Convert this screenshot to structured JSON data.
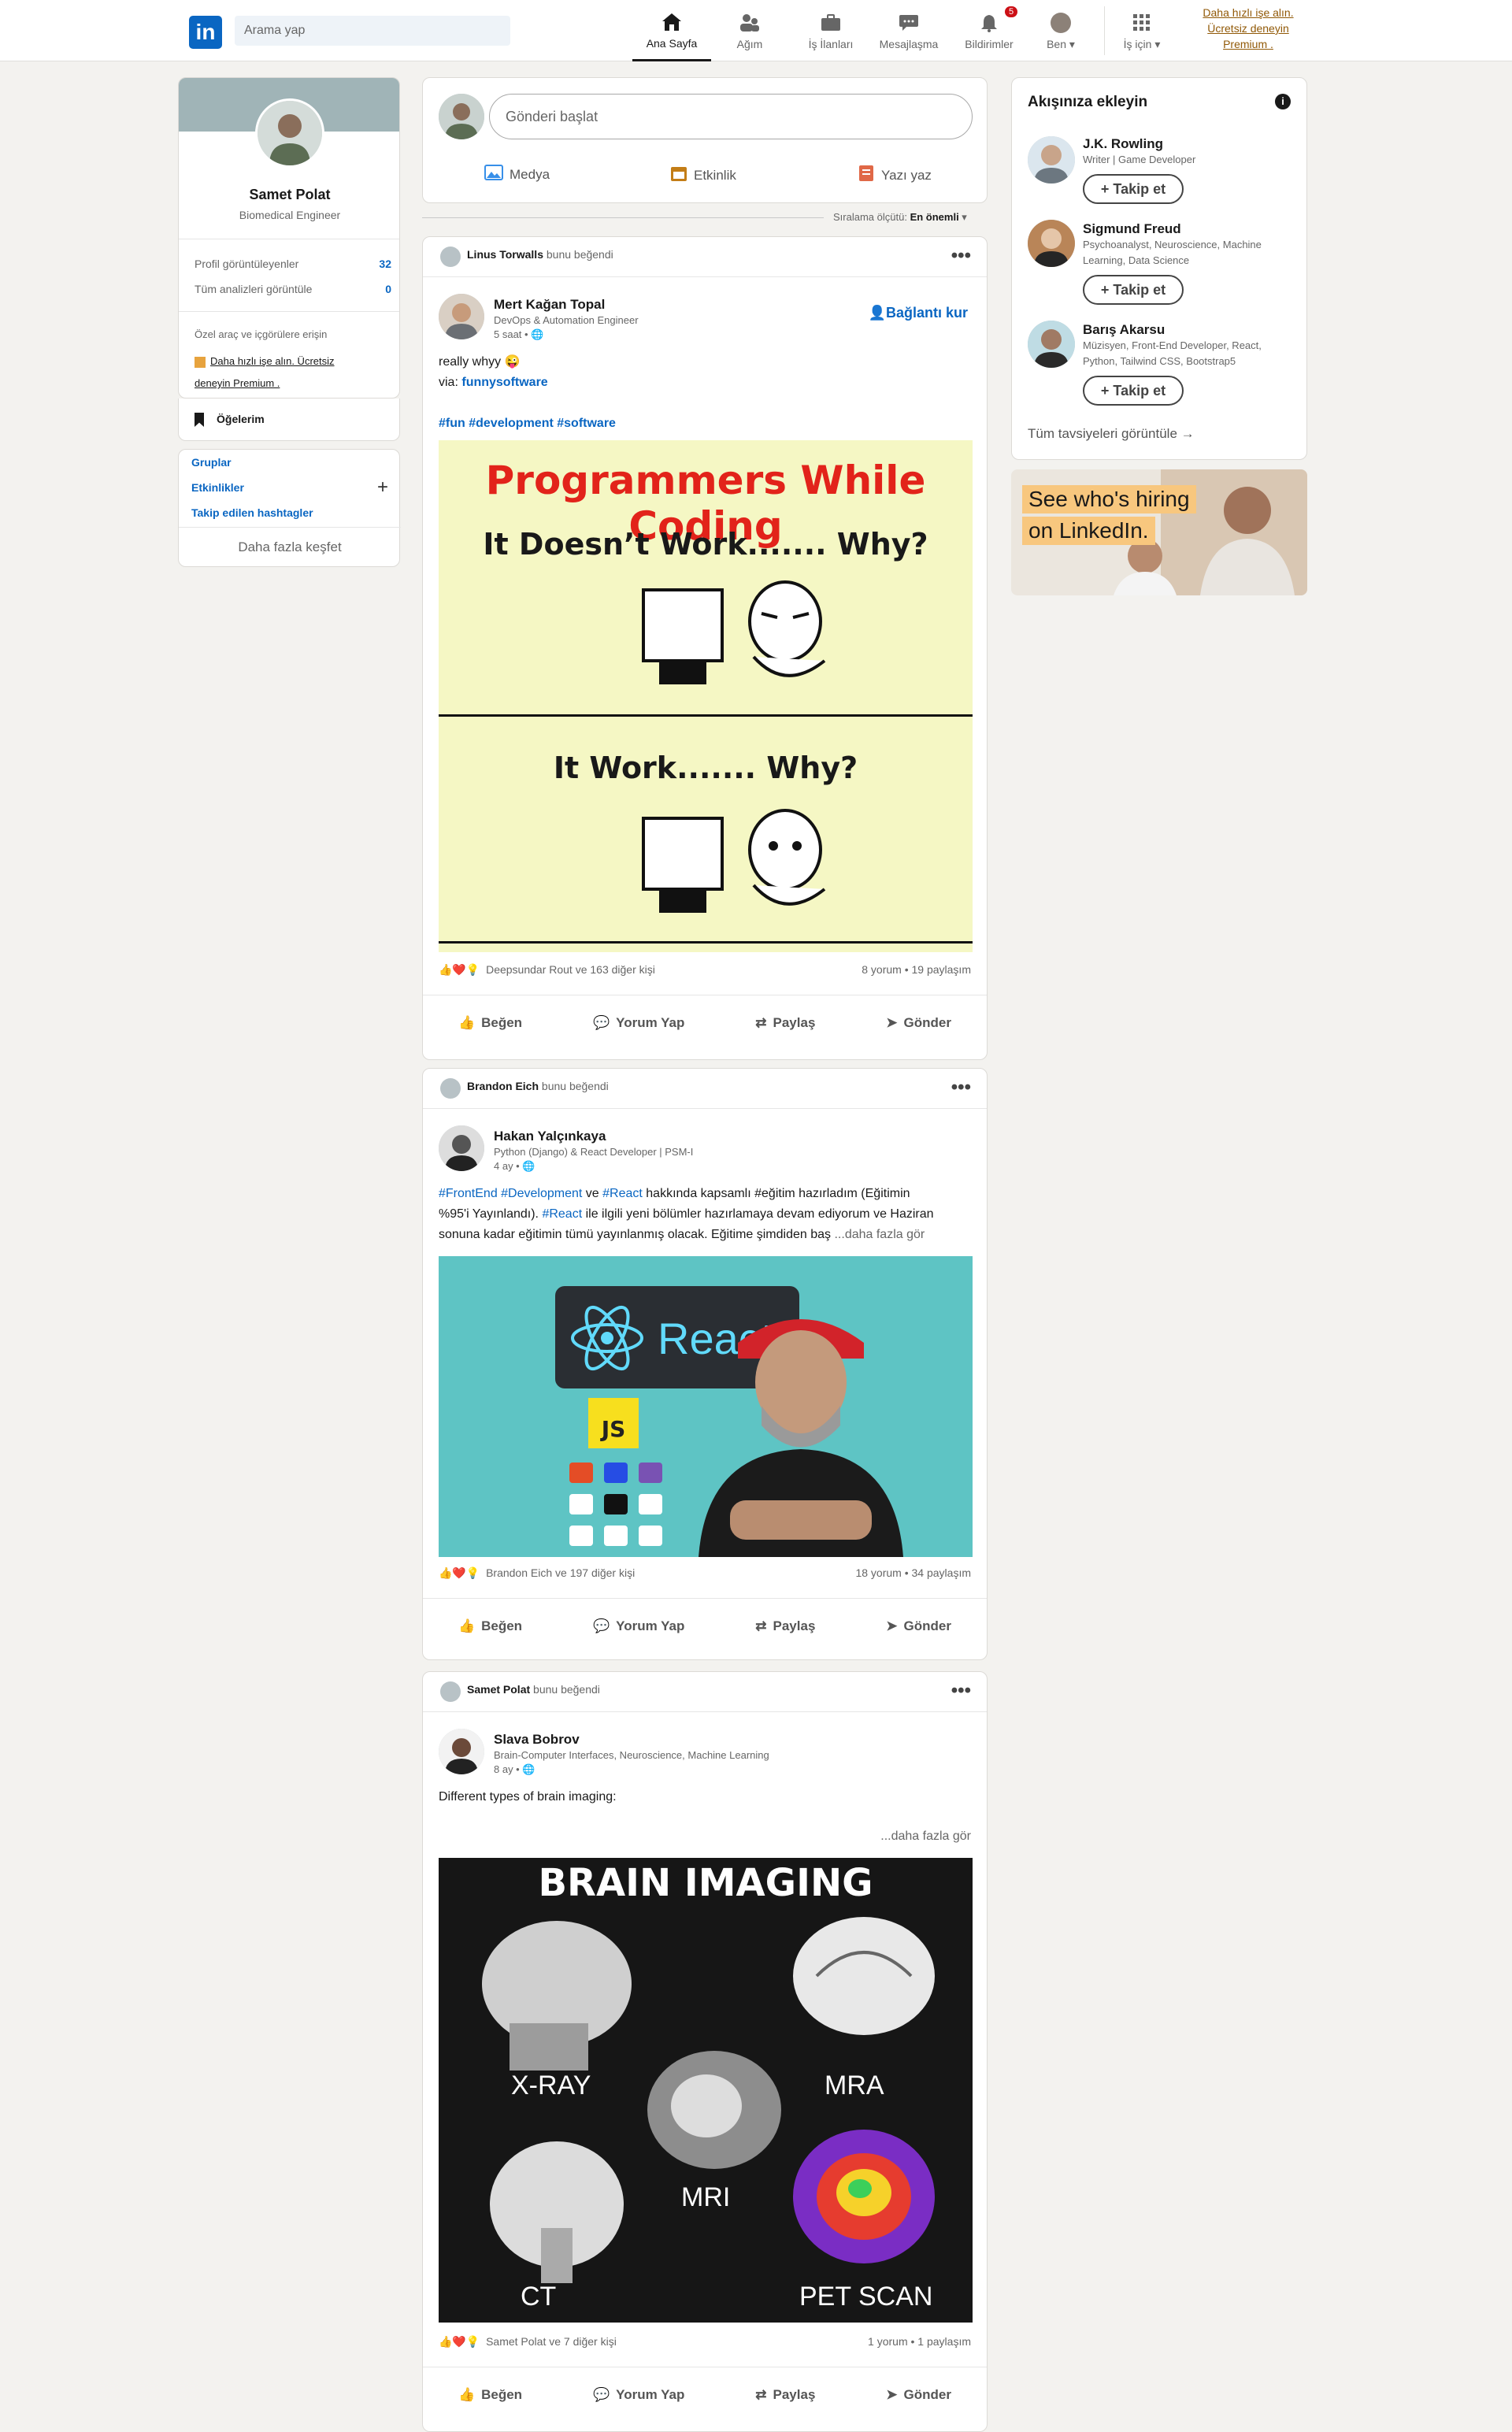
{
  "topbar": {
    "search_placeholder": "Arama yap",
    "nav": [
      {
        "label": "Ana Sayfa",
        "icon": "home-icon"
      },
      {
        "label": "Ağım",
        "icon": "network-icon"
      },
      {
        "label": "İş İlanları",
        "icon": "briefcase-icon"
      },
      {
        "label": "Mesajlaşma",
        "icon": "message-icon"
      },
      {
        "label": "Bildirimler",
        "icon": "bell-icon",
        "badge": "5"
      },
      {
        "label": "Ben",
        "icon": "avatar-icon"
      },
      {
        "label": "İş için",
        "icon": "grid-icon"
      }
    ],
    "premium": "Daha hızlı işe alın. Ücretsiz deneyin Premium ."
  },
  "profile": {
    "name": "Samet Polat",
    "headline": "Biomedical Engineer",
    "viewers_label": "Profil görüntüleyenler",
    "viewers_value": "32",
    "analytics_label": "Tüm analizleri görüntüle",
    "analytics_value": "0",
    "tools_label": "Özel araç ve içgörülere erişin",
    "premium_line1": "Daha hızlı işe alın. Ücretsiz",
    "premium_line2": "deneyin Premium .",
    "items_label": "Öğelerim"
  },
  "communities": {
    "groups": "Gruplar",
    "events": "Etkinlikler",
    "hashtags": "Takip edilen hashtagler",
    "discover": "Daha fazla keşfet"
  },
  "composer": {
    "placeholder": "Gönderi başlat",
    "media": "Medya",
    "event": "Etkinlik",
    "article": "Yazı yaz"
  },
  "sort": {
    "label": "Sıralama ölçütü:",
    "value": "En önemli"
  },
  "posts": [
    {
      "liker": "Linus Torwalls",
      "liked": "bunu beğendi",
      "author": "Mert Kağan Topal",
      "desc": "DevOps & Automation Engineer",
      "time": "5 saat •",
      "connect": "Bağlantı kur",
      "text1": "really whyy 😜",
      "text2_prefix": "via:",
      "text2_link": "funnysoftware",
      "hashtags": "#fun #development #software",
      "meme_title": "Programmers While Coding",
      "meme_q1": "It Doesn’t Work....... Why?",
      "meme_q2": "It Work....... Why?",
      "reactions": "Deepsundar Rout ve 163 diğer kişi",
      "counts": "8 yorum • 19 paylaşım"
    },
    {
      "liker": "Brandon Eich",
      "liked": "bunu beğendi",
      "author": "Hakan Yalçınkaya",
      "desc": "Python (Django) & React Developer | PSM-I",
      "time": "4 ay •",
      "text_line1_a": "#FrontEnd #Development",
      "text_line1_b": " ve ",
      "text_line1_c": "#React",
      "text_line1_d": " hakkında kapsamlı #eğitim hazırladım (Eğitimin",
      "text_line2_a": "%95'i Yayınlandı). ",
      "text_line2_b": "#React",
      "text_line2_c": " ile ilgili yeni bölümler hazırlamaya devam ediyorum ve Haziran",
      "text_line3": "sonuna kadar eğitimin tümü yayınlanmış olacak. Eğitime şimdiden baş",
      "more": "...daha fazla gör",
      "image_word": "React",
      "image_js": "JS",
      "reactions": "Brandon Eich ve 197 diğer kişi",
      "counts": "18 yorum • 34 paylaşım"
    },
    {
      "liker": "Samet Polat",
      "liked": "bunu beğendi",
      "author": "Slava Bobrov",
      "desc": "Brain-Computer Interfaces, Neuroscience, Machine Learning",
      "time": "8 ay •",
      "text1": "Different types of brain imaging:",
      "more": "...daha fazla gör",
      "image_title": "BRAIN IMAGING",
      "labels": [
        "X-RAY",
        "MRA",
        "MRI",
        "CT",
        "PET SCAN"
      ],
      "reactions": "Samet Polat ve 7 diğer kişi",
      "counts": "1 yorum • 1 paylaşım"
    }
  ],
  "actions": {
    "like": "Beğen",
    "comment": "Yorum Yap",
    "repost": "Paylaş",
    "send": "Gönder"
  },
  "suggestions": {
    "title": "Akışınıza ekleyin",
    "people": [
      {
        "name": "J.K. Rowling",
        "desc1": "Writer | Game Developer",
        "desc2": ""
      },
      {
        "name": "Sigmund Freud",
        "desc1": "Psychoanalyst, Neuroscience, Machine",
        "desc2": "Learning, Data Science"
      },
      {
        "name": "Barış Akarsu",
        "desc1": "Müzisyen, Front-End Developer, React,",
        "desc2": "Python, Tailwind CSS, Bootstrap5"
      }
    ],
    "follow": "Takip et",
    "all": "Tüm tavsiyeleri görüntüle →"
  },
  "ad": {
    "line1": "See who's hiring",
    "line2": "on LinkedIn."
  },
  "colors": {
    "brand": "#0a66c2",
    "bg": "#f3f2ef",
    "premium": "#915907"
  }
}
